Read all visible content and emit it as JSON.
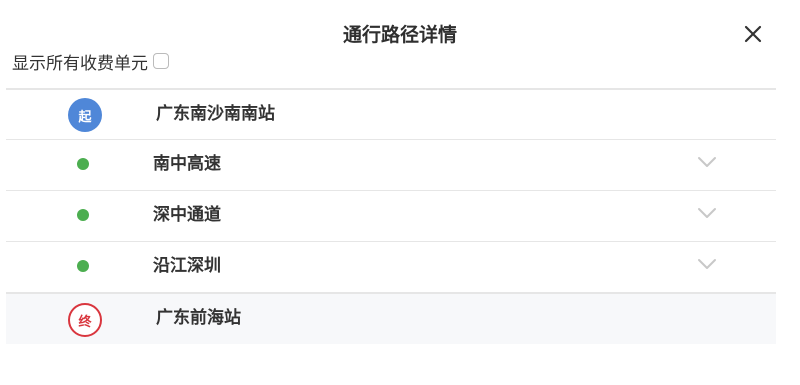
{
  "dialog": {
    "title": "通行路径详情",
    "show_all_label": "显示所有收费单元",
    "show_all_checked": false
  },
  "route": {
    "start": {
      "badge": "起",
      "name": "广东南沙南南站"
    },
    "segments": [
      {
        "name": "南中高速",
        "icon": "chevron-down-icon"
      },
      {
        "name": "深中通道",
        "icon": "chevron-down-icon"
      },
      {
        "name": "沿江深圳",
        "icon": "chevron-down-icon"
      }
    ],
    "end": {
      "badge": "终",
      "name": "广东前海站"
    }
  },
  "colors": {
    "start_badge": "#4f87d8",
    "end_badge": "#d9363e",
    "segment_dot": "#4cae50"
  }
}
